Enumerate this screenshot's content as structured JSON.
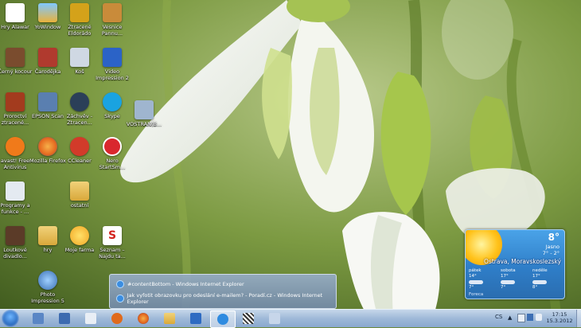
{
  "desktop": {
    "icons": [
      {
        "label": "Hry Alawar",
        "icon": "document-icon",
        "color": "#ffffff"
      },
      {
        "label": "YoWindow",
        "icon": "yowindow-icon",
        "color": "#e9b23b"
      },
      {
        "label": "Ztracené Eldorádo",
        "icon": "pyramid-game-icon",
        "color": "#d4a21a"
      },
      {
        "label": "Vesnice Pannu...",
        "icon": "game-icon",
        "color": "#c98b3a"
      },
      {
        "label": "Černý kocour",
        "icon": "game-character-icon",
        "color": "#7a4c2e"
      },
      {
        "label": "Čarodějka",
        "icon": "witch-game-icon",
        "color": "#b03a2e"
      },
      {
        "label": "Koš",
        "icon": "recycle-bin-icon",
        "color": "#cfd8e3"
      },
      {
        "label": "Video Impression 2",
        "icon": "video-impression-icon",
        "color": "#2b63c7"
      },
      {
        "label": "Proroctví ztracené...",
        "icon": "game-icon",
        "color": "#a33b1e"
      },
      {
        "label": "EPSON Scan",
        "icon": "scanner-icon",
        "color": "#5a7fb0"
      },
      {
        "label": "Záchvěv - Ztracen...",
        "icon": "game-icon",
        "color": "#2b3f58"
      },
      {
        "label": "Skype",
        "icon": "skype-icon",
        "color": "#1aa3e0"
      },
      {
        "label": "VOSTRAN(B...",
        "icon": "network-drive-icon",
        "color": "#9fb5cf"
      },
      {
        "label": "avast! Free Antivirus",
        "icon": "avast-icon",
        "color": "#f07a1a"
      },
      {
        "label": "Mozilla Firefox",
        "icon": "firefox-icon",
        "color": "#e66a1f"
      },
      {
        "label": "CCleaner",
        "icon": "ccleaner-icon",
        "color": "#d23b2a"
      },
      {
        "label": "Nero StartSm...",
        "icon": "nero-icon",
        "color": "#d9272e"
      },
      {
        "label": "Programy a funkce - ...",
        "icon": "programs-icon",
        "color": "#e4eaf1"
      },
      {
        "label": "ostatní",
        "icon": "folder-icon",
        "color": "#e7c259"
      },
      {
        "label": "Loutkové divadlo...",
        "icon": "game-icon",
        "color": "#5b3b28"
      },
      {
        "label": "hry",
        "icon": "folder-icon",
        "color": "#e7c259"
      },
      {
        "label": "Moje farma",
        "icon": "flower-game-icon",
        "color": "#f2a623"
      },
      {
        "label": "Seznam – Najdu ta...",
        "icon": "seznam-icon",
        "color": "#ffffff"
      },
      {
        "label": "Photo Impression 5",
        "icon": "photo-impression-icon",
        "color": "#3a6fb3"
      }
    ]
  },
  "weather": {
    "temperature": "8°",
    "condition": "Jasno",
    "range": "7° - 2°",
    "location": "Ostrava, Moravskoslezský",
    "days": [
      {
        "name": "pátek",
        "hi": "14°",
        "lo": "7°"
      },
      {
        "name": "sobota",
        "hi": "17°",
        "lo": "7°"
      },
      {
        "name": "neděle",
        "hi": "17°",
        "lo": "8°"
      }
    ],
    "source": "Foreca"
  },
  "thumbnail_popup": {
    "items": [
      "#contentBottom - Windows Internet Explorer",
      "Jak vyfotit obrazovku pro odeslání e-mailem? - Poradí.cz - Windows Internet Explorer"
    ]
  },
  "taskbar": {
    "buttons": [
      {
        "icon": "network-icon",
        "color": "#5a86c5",
        "active": false
      },
      {
        "icon": "paint-brush-icon",
        "color": "#3d6bb0",
        "active": false
      },
      {
        "icon": "notepad-icon",
        "color": "#e9eef5",
        "active": false
      },
      {
        "icon": "media-player-icon",
        "color": "#e06a1c",
        "active": false
      },
      {
        "icon": "firefox-icon",
        "color": "#e0621d",
        "active": false
      },
      {
        "icon": "explorer-folder-icon",
        "color": "#e6c257",
        "active": false
      },
      {
        "icon": "windows-logo-icon",
        "color": "#2e6bc2",
        "active": false
      },
      {
        "icon": "internet-explorer-icon",
        "color": "#2f8be0",
        "active": true
      },
      {
        "icon": "zebra-icon",
        "color": "#333333",
        "active": false
      },
      {
        "icon": "paint-icon",
        "color": "#c7d6ea",
        "active": false
      }
    ],
    "language": "CS",
    "time": "17:15",
    "date": "15.3.2012"
  }
}
